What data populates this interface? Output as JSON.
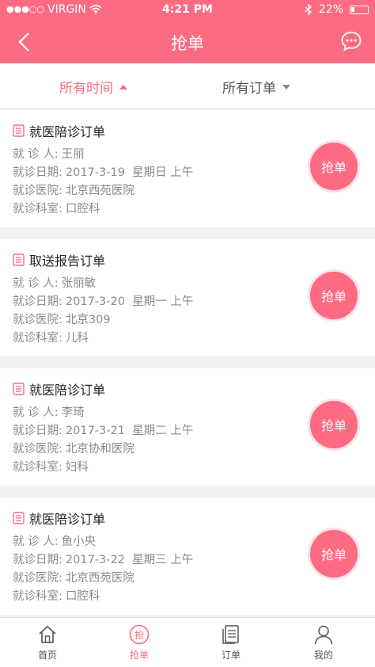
{
  "status_bar": {
    "signal": "●●●○○",
    "carrier": "VIRGIN",
    "time": "4:21 PM",
    "battery": "22%",
    "icons": [
      "wifi-icon",
      "bluetooth-icon",
      "battery-icon"
    ]
  },
  "nav": {
    "title": "抢单",
    "back_icon": "chevron-left-icon",
    "chat_icon": "chat-bubble-icon"
  },
  "filters": {
    "time_label": "所有时间",
    "order_label": "所有订单"
  },
  "orders": [
    {
      "title": "就医陪诊订单",
      "patient_label": "就 诊 人:",
      "patient": "王丽",
      "date_label": "就诊日期:",
      "date": "2017-3-19  星期日 上午",
      "hospital_label": "就诊医院:",
      "hospital": "北京西苑医院",
      "dept_label": "就诊科室:",
      "dept": "口腔科",
      "button": "抢单"
    },
    {
      "title": "取送报告订单",
      "patient_label": "就 诊 人:",
      "patient": "张丽敏",
      "date_label": "就诊日期:",
      "date": "2017-3-20  星期一 上午",
      "hospital_label": "就诊医院:",
      "hospital": "北京309",
      "dept_label": "就诊科室:",
      "dept": "儿科",
      "button": "抢单"
    },
    {
      "title": "就医陪诊订单",
      "patient_label": "就 诊 人:",
      "patient": "李琦",
      "date_label": "就诊日期:",
      "date": "2017-3-21  星期二 上午",
      "hospital_label": "就诊医院:",
      "hospital": "北京协和医院",
      "dept_label": "就诊科室:",
      "dept": "妇科",
      "button": "抢单"
    },
    {
      "title": "就医陪诊订单",
      "patient_label": "就 诊 人:",
      "patient": "鱼小央",
      "date_label": "就诊日期:",
      "date": "2017-3-22  星期三 上午",
      "hospital_label": "就诊医院:",
      "hospital": "北京西苑医院",
      "dept_label": "就诊科室:",
      "dept": "口腔科",
      "button": "抢单"
    }
  ],
  "tabbar": {
    "items": [
      {
        "label": "首页",
        "icon": "home-icon"
      },
      {
        "label": "抢单",
        "icon": "grab-order-icon",
        "active": true
      },
      {
        "label": "订单",
        "icon": "order-list-icon"
      },
      {
        "label": "我的",
        "icon": "user-icon"
      }
    ]
  },
  "colors": {
    "accent": "#fc6b82",
    "background": "#f1f1f1"
  }
}
